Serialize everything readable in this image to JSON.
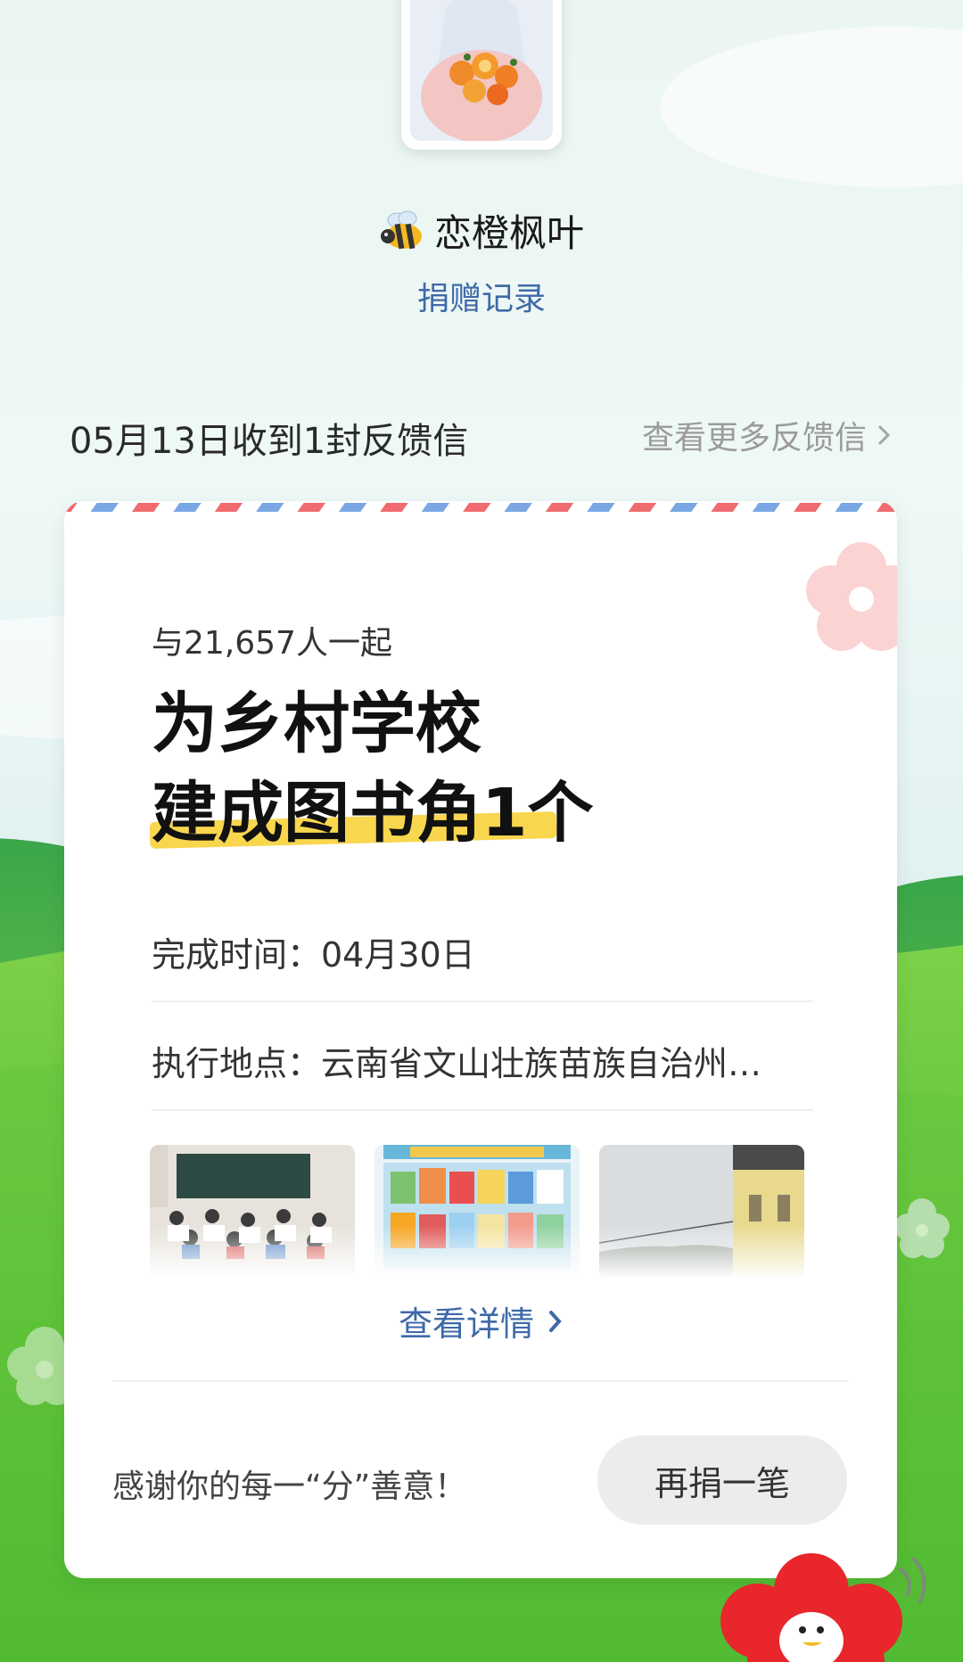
{
  "profile": {
    "username": "恋橙枫叶",
    "donation_link": "捐赠记录"
  },
  "feedback_header": {
    "title": "05月13日收到1封反馈信",
    "more_link": "查看更多反馈信"
  },
  "card": {
    "together": "与21,657人一起",
    "headline_line1": "为乡村学校",
    "headline_line2": "建成图书角1个",
    "completion_time": "完成时间：04月30日",
    "location": "执行地点：云南省文山壮族苗族自治州…",
    "detail_link": "查看详情",
    "thanks": "感谢你的每一“分”善意！",
    "redonate_button": "再捐一笔"
  },
  "colors": {
    "link_blue": "#3f6aa8",
    "highlight_yellow": "#f8d64e",
    "stripe_red": "#ef6b6f",
    "stripe_blue": "#7aa7e4",
    "grass_green": "#5cc23a"
  }
}
